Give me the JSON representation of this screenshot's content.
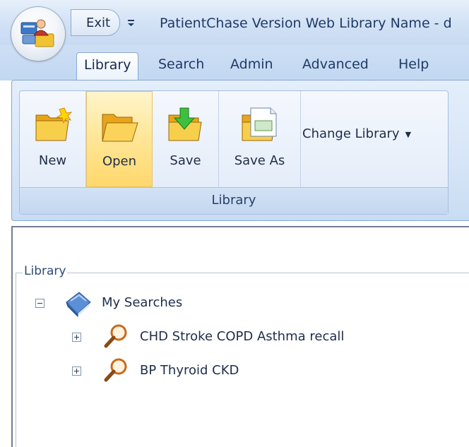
{
  "titlebar": {
    "exit_label": "Exit",
    "window_title": "PatientChase Version Web  Library Name - d"
  },
  "tabs": [
    {
      "label": "Library",
      "active": true
    },
    {
      "label": "Search",
      "active": false
    },
    {
      "label": "Admin",
      "active": false
    },
    {
      "label": "Advanced",
      "active": false
    },
    {
      "label": "Help",
      "active": false
    }
  ],
  "ribbon": {
    "group_label": "Library",
    "buttons": [
      {
        "label": "New",
        "icon": "new-folder-icon"
      },
      {
        "label": "Open",
        "icon": "open-folder-icon",
        "hover": true
      },
      {
        "label": "Save",
        "icon": "save-folder-icon"
      },
      {
        "label": "Save As",
        "icon": "save-as-folder-icon"
      }
    ],
    "change_library_label": "Change Library"
  },
  "library_panel": {
    "legend": "Library",
    "root": {
      "label": "My Searches",
      "expanded": true,
      "icon": "book-icon"
    },
    "children": [
      {
        "label": "CHD Stroke COPD Asthma recall",
        "expanded": false,
        "icon": "magnifier-icon"
      },
      {
        "label": "BP Thyroid CKD",
        "expanded": false,
        "icon": "magnifier-icon"
      }
    ]
  },
  "colors": {
    "ribbon_blue": "#d6e5f7",
    "hover_gold": "#ffd86c",
    "text_navy": "#1f3a66"
  }
}
